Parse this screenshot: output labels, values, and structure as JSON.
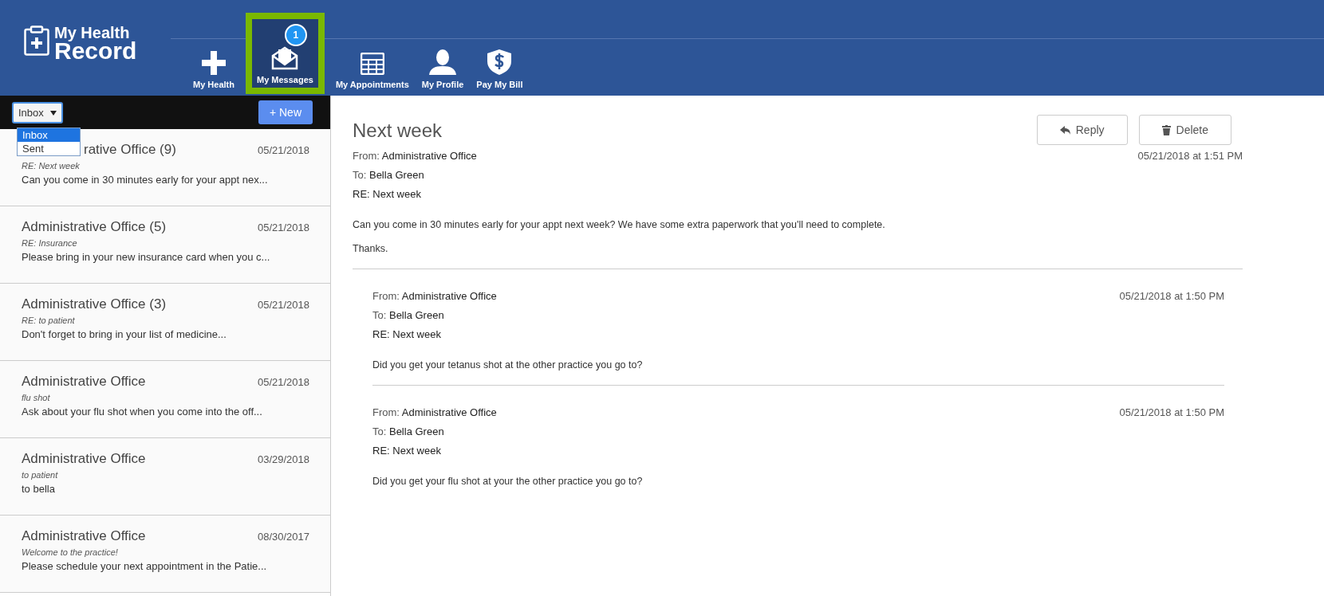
{
  "app": {
    "logo_line1": "My Health",
    "logo_line2": "Record"
  },
  "nav": [
    {
      "label": "My Health",
      "kind": "plus",
      "selected": false
    },
    {
      "label": "My Messages",
      "kind": "envelope",
      "selected": true,
      "badge": "1"
    },
    {
      "label": "My Appointments",
      "kind": "calendar",
      "selected": false
    },
    {
      "label": "My Profile",
      "kind": "person",
      "selected": false
    },
    {
      "label": "Pay My Bill",
      "kind": "dollar",
      "selected": false
    }
  ],
  "folder_select": {
    "value": "Inbox",
    "expanded": true,
    "options": [
      {
        "label": "Inbox",
        "selected": true
      },
      {
        "label": "Sent",
        "selected": false
      }
    ]
  },
  "new_button": "+ New",
  "messages": [
    {
      "sender": "rative Office (9)",
      "date": "05/21/2018",
      "subject": "RE: Next week",
      "preview": "Can you come in 30 minutes early for your appt nex..."
    },
    {
      "sender": "Administrative Office (5)",
      "date": "05/21/2018",
      "subject": "RE: Insurance",
      "preview": "Please bring in your new insurance card when you c..."
    },
    {
      "sender": "Administrative Office (3)",
      "date": "05/21/2018",
      "subject": "RE: to patient",
      "preview": "Don't forget to bring in your list of medicine..."
    },
    {
      "sender": "Administrative Office",
      "date": "05/21/2018",
      "subject": "flu shot",
      "preview": "Ask about your flu shot when you come into the off..."
    },
    {
      "sender": "Administrative Office",
      "date": "03/29/2018",
      "subject": "to patient",
      "preview": "to bella"
    },
    {
      "sender": "Administrative Office",
      "date": "08/30/2017",
      "subject": "Welcome to the practice!",
      "preview": "Please schedule your next appointment in the Patie..."
    }
  ],
  "detail": {
    "title": "Next week",
    "reply_button": "Reply",
    "delete_button": "Delete",
    "message": {
      "from_label": "From:",
      "from": "Administrative Office",
      "to_label": "To:",
      "to": "Bella Green",
      "re": "RE: Next week",
      "date": "05/21/2018 at 1:51 PM",
      "body": [
        "Can you come in 30 minutes early for your appt next week? We have some extra paperwork that you'll need to complete.",
        "Thanks."
      ],
      "children": [
        {
          "from_label": "From:",
          "from": "Administrative Office",
          "to_label": "To:",
          "to": "Bella Green",
          "re": "RE: Next week",
          "date": "05/21/2018 at 1:50 PM",
          "body": [
            "Did you get your tetanus shot at the other practice you go to?"
          ]
        },
        {
          "from_label": "From:",
          "from": "Administrative Office",
          "to_label": "To:",
          "to": "Bella Green",
          "re": "RE: Next week",
          "date": "05/21/2018 at 1:50 PM",
          "body": [
            "Did you get your flu shot at your the other practice you go to?"
          ]
        }
      ]
    }
  }
}
